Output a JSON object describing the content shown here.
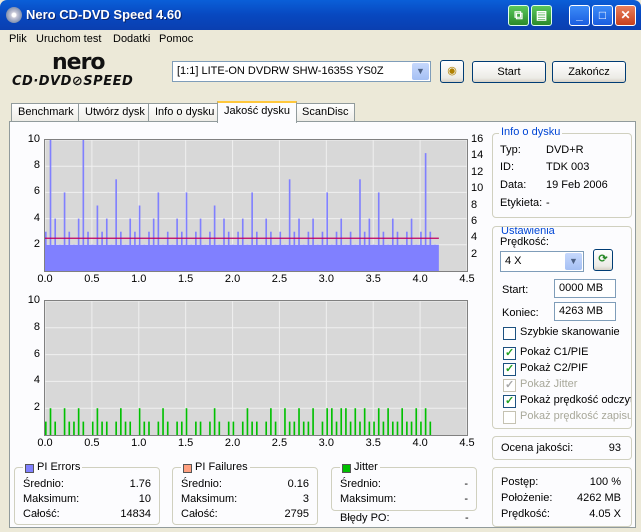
{
  "window": {
    "title": "Nero CD-DVD Speed 4.60"
  },
  "menu": [
    "Plik",
    "Uruchom test",
    "Dodatki",
    "Pomoc"
  ],
  "logo": {
    "line1": "nero",
    "line2": "CD·DVD⊘SPEED"
  },
  "toolbar": {
    "drive": "[1:1]  LITE-ON DVDRW SHW-1635S YS0Z",
    "start": "Start",
    "stop": "Zakończ"
  },
  "tabs": [
    "Benchmark",
    "Utwórz dysk",
    "Info o dysku",
    "Jakość dysku",
    "ScanDisc"
  ],
  "active_tab": "Jakość dysku",
  "colors": {
    "pie": "#8080ff",
    "pif": "#00c000",
    "speed": "#c00060",
    "jitter": "#00c000"
  },
  "chart_data": [
    {
      "type": "bar",
      "name": "PI Errors",
      "x": [
        0,
        0.05,
        0.1,
        0.15,
        0.2,
        0.25,
        0.3,
        0.35,
        0.4,
        0.45,
        0.5,
        0.55,
        0.6,
        0.65,
        0.7,
        0.75,
        0.8,
        0.85,
        0.9,
        0.95,
        1.0,
        1.05,
        1.1,
        1.15,
        1.2,
        1.25,
        1.3,
        1.35,
        1.4,
        1.45,
        1.5,
        1.55,
        1.6,
        1.65,
        1.7,
        1.75,
        1.8,
        1.85,
        1.9,
        1.95,
        2.0,
        2.05,
        2.1,
        2.15,
        2.2,
        2.25,
        2.3,
        2.35,
        2.4,
        2.45,
        2.5,
        2.55,
        2.6,
        2.65,
        2.7,
        2.75,
        2.8,
        2.85,
        2.9,
        2.95,
        3.0,
        3.05,
        3.1,
        3.15,
        3.2,
        3.25,
        3.3,
        3.35,
        3.4,
        3.45,
        3.5,
        3.55,
        3.6,
        3.65,
        3.7,
        3.75,
        3.8,
        3.85,
        3.9,
        3.95,
        4.0,
        4.05,
        4.1,
        4.15
      ],
      "values": [
        3,
        10,
        4,
        2,
        6,
        3,
        2,
        4,
        10,
        3,
        2,
        5,
        3,
        4,
        2,
        7,
        3,
        2,
        4,
        3,
        5,
        2,
        3,
        4,
        6,
        2,
        3,
        2,
        4,
        3,
        6,
        2,
        3,
        4,
        2,
        3,
        5,
        2,
        4,
        3,
        2,
        3,
        4,
        2,
        6,
        3,
        2,
        4,
        3,
        2,
        3,
        2,
        7,
        3,
        4,
        2,
        3,
        4,
        2,
        3,
        6,
        2,
        3,
        4,
        2,
        3,
        2,
        7,
        3,
        4,
        2,
        6,
        3,
        2,
        4,
        3,
        2,
        3,
        4,
        2,
        3,
        9,
        3,
        2
      ],
      "xlim": [
        0,
        4.5
      ],
      "ylim_left": [
        0,
        10
      ],
      "ylim_right": [
        0,
        16
      ],
      "yticks_left": [
        2,
        4,
        6,
        8,
        10
      ],
      "yticks_right": [
        2,
        4,
        6,
        8,
        10,
        12,
        14,
        16
      ],
      "xticks": [
        "0.0",
        "0.5",
        "1.0",
        "1.5",
        "2.0",
        "2.5",
        "3.0",
        "3.5",
        "4.0",
        "4.5"
      ],
      "speed_line": {
        "x": [
          0,
          4.2
        ],
        "y": [
          4,
          4
        ]
      }
    },
    {
      "type": "bar",
      "name": "PI Failures",
      "x": [
        0,
        0.05,
        0.1,
        0.15,
        0.2,
        0.25,
        0.3,
        0.35,
        0.4,
        0.45,
        0.5,
        0.55,
        0.6,
        0.65,
        0.7,
        0.75,
        0.8,
        0.85,
        0.9,
        0.95,
        1.0,
        1.05,
        1.1,
        1.15,
        1.2,
        1.25,
        1.3,
        1.35,
        1.4,
        1.45,
        1.5,
        1.55,
        1.6,
        1.65,
        1.7,
        1.75,
        1.8,
        1.85,
        1.9,
        1.95,
        2.0,
        2.05,
        2.1,
        2.15,
        2.2,
        2.25,
        2.3,
        2.35,
        2.4,
        2.45,
        2.5,
        2.55,
        2.6,
        2.65,
        2.7,
        2.75,
        2.8,
        2.85,
        2.9,
        2.95,
        3.0,
        3.05,
        3.1,
        3.15,
        3.2,
        3.25,
        3.3,
        3.35,
        3.4,
        3.45,
        3.5,
        3.55,
        3.6,
        3.65,
        3.7,
        3.75,
        3.8,
        3.85,
        3.9,
        3.95,
        4.0,
        4.05,
        4.1,
        4.15
      ],
      "values": [
        1,
        2,
        1,
        0,
        2,
        1,
        1,
        2,
        1,
        0,
        1,
        2,
        1,
        1,
        0,
        1,
        2,
        1,
        1,
        0,
        2,
        1,
        1,
        0,
        1,
        2,
        1,
        0,
        1,
        1,
        2,
        0,
        1,
        1,
        0,
        1,
        2,
        1,
        0,
        1,
        1,
        0,
        1,
        2,
        1,
        1,
        0,
        1,
        2,
        1,
        0,
        2,
        1,
        1,
        2,
        1,
        1,
        2,
        0,
        1,
        2,
        2,
        1,
        2,
        2,
        1,
        2,
        1,
        2,
        1,
        1,
        2,
        1,
        2,
        1,
        1,
        2,
        1,
        1,
        2,
        1,
        2,
        1,
        0
      ],
      "xlim": [
        0,
        4.5
      ],
      "ylim": [
        0,
        10
      ],
      "yticks": [
        2,
        4,
        6,
        8,
        10
      ],
      "xticks": [
        "0.0",
        "0.5",
        "1.0",
        "1.5",
        "2.0",
        "2.5",
        "3.0",
        "3.5",
        "4.0",
        "4.5"
      ]
    }
  ],
  "disc_info": {
    "label": "Info o dysku",
    "rows": [
      {
        "k": "Typ:",
        "v": "DVD+R"
      },
      {
        "k": "ID:",
        "v": "TDK 003"
      },
      {
        "k": "Data:",
        "v": "19 Feb 2006"
      },
      {
        "k": "Etykieta:",
        "v": "-"
      }
    ]
  },
  "settings": {
    "label": "Ustawienia",
    "speed_label": "Prędkość:",
    "speed": "4 X",
    "start_label": "Start:",
    "start": "0000 MB",
    "end_label": "Koniec:",
    "end": "4263 MB",
    "checks": [
      {
        "label": "Szybkie skanowanie",
        "checked": false,
        "disabled": false
      },
      {
        "label": "Pokaż C1/PIE",
        "checked": true,
        "disabled": false
      },
      {
        "label": "Pokaż C2/PIF",
        "checked": true,
        "disabled": false
      },
      {
        "label": "Pokaż Jitter",
        "checked": true,
        "disabled": true
      },
      {
        "label": "Pokaż prędkość odczytu",
        "checked": true,
        "disabled": false
      },
      {
        "label": "Pokaż prędkość zapisu",
        "checked": false,
        "disabled": true
      }
    ]
  },
  "quality": {
    "label": "Ocena jakości:",
    "value": "93"
  },
  "progress": {
    "rows": [
      {
        "k": "Postęp:",
        "v": "100 %"
      },
      {
        "k": "Położenie:",
        "v": "4262 MB"
      },
      {
        "k": "Prędkość:",
        "v": "4.05 X"
      }
    ]
  },
  "stats": {
    "pie": {
      "label": "PI Errors",
      "rows": [
        {
          "k": "Średnio:",
          "v": "1.76"
        },
        {
          "k": "Maksimum:",
          "v": "10"
        },
        {
          "k": "Całość:",
          "v": "14834"
        }
      ]
    },
    "pif": {
      "label": "PI Failures",
      "rows": [
        {
          "k": "Średnio:",
          "v": "0.16"
        },
        {
          "k": "Maksimum:",
          "v": "3"
        },
        {
          "k": "Całość:",
          "v": "2795"
        }
      ]
    },
    "jitter": {
      "label": "Jitter",
      "rows": [
        {
          "k": "Średnio:",
          "v": "-"
        },
        {
          "k": "Maksimum:",
          "v": "-"
        }
      ]
    },
    "po_label": "Błędy PO:",
    "po_value": "-"
  }
}
